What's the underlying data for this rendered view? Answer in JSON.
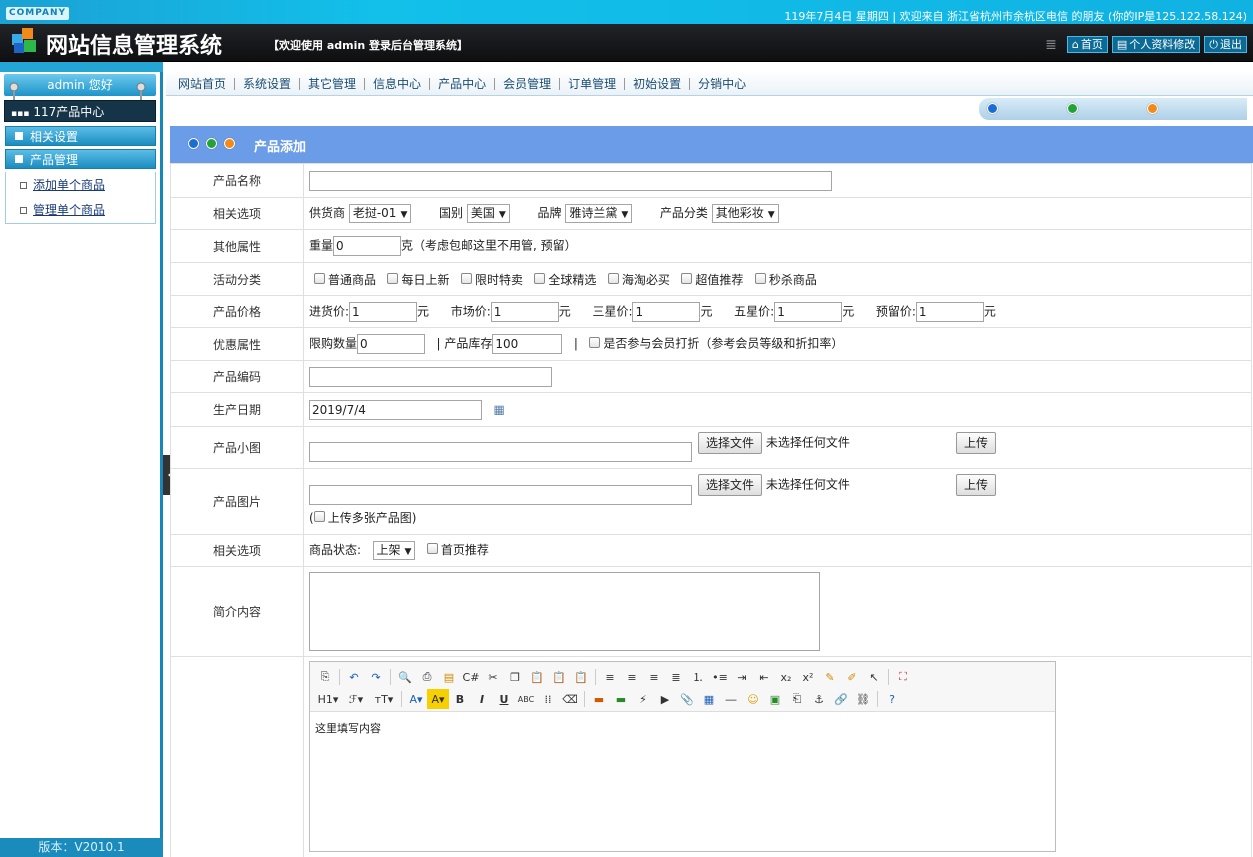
{
  "header": {
    "logo_badge": "COMPANY",
    "info": "119年7月4日  星期四 | 欢迎来自 浙江省杭州市余杭区电信 的朋友 (你的IP是125.122.58.124)",
    "site_title": "网站信息管理系统",
    "welcome": "【欢迎使用 admin 登录后台管理系统】",
    "buttons": {
      "home": "首页",
      "profile": "个人资料修改",
      "logout": "退出"
    }
  },
  "sidebar": {
    "user": "admin 您好",
    "center": "117产品中心",
    "sections": [
      {
        "label": "相关设置"
      },
      {
        "label": "产品管理"
      }
    ],
    "items": [
      {
        "label": "添加单个商品"
      },
      {
        "label": "管理单个商品"
      }
    ],
    "version": "版本：V2010.1"
  },
  "nav": {
    "items": [
      {
        "label": "网站首页"
      },
      {
        "label": "系统设置"
      },
      {
        "label": "其它管理"
      },
      {
        "label": "信息中心"
      },
      {
        "label": "产品中心"
      },
      {
        "label": "会员管理"
      },
      {
        "label": "订单管理"
      },
      {
        "label": "初始设置"
      },
      {
        "label": "分销中心"
      }
    ]
  },
  "colors": {
    "accent_blue": "#1b8bbc",
    "title_bar": "#6a9ce8",
    "dot_blue": "#1a6dd4",
    "dot_green": "#22a33a",
    "dot_orange": "#f28a1a"
  },
  "form": {
    "title": "产品添加",
    "rows": {
      "name": {
        "label": "产品名称",
        "value": ""
      },
      "options": {
        "label": "相关选项",
        "supplier_label": "供货商",
        "supplier_value": "老挝-01",
        "country_label": "国别",
        "country_value": "美国",
        "brand_label": "品牌",
        "brand_value": "雅诗兰黛",
        "category_label": "产品分类",
        "category_value": "其他彩妆"
      },
      "other": {
        "label": "其他属性",
        "weight_label": "重量",
        "weight_value": "0",
        "weight_note": "克（考虑包邮这里不用管, 预留）"
      },
      "activity": {
        "label": "活动分类",
        "options": [
          "普通商品",
          "每日上新",
          "限时特卖",
          "全球精选",
          "海淘必买",
          "超值推荐",
          "秒杀商品"
        ]
      },
      "price": {
        "label": "产品价格",
        "purchase_label": "进货价:",
        "purchase_value": "1",
        "market_label": "市场价:",
        "market_value": "1",
        "three_label": "三星价:",
        "three_value": "1",
        "five_label": "五星价:",
        "five_value": "1",
        "reserve_label": "预留价:",
        "reserve_value": "1",
        "unit": "元"
      },
      "discount": {
        "label": "优惠属性",
        "limit_label": "限购数量",
        "limit_value": "0",
        "sep": "|",
        "stock_label": "产品库存",
        "stock_value": "100",
        "member_label": "是否参与会员打折（参考会员等级和折扣率）"
      },
      "code": {
        "label": "产品编码",
        "value": ""
      },
      "date": {
        "label": "生产日期",
        "value": "2019/7/4"
      },
      "small_image": {
        "label": "产品小图",
        "choose": "选择文件",
        "none": "未选择任何文件",
        "upload": "上传"
      },
      "image": {
        "label": "产品图片",
        "choose": "选择文件",
        "none": "未选择任何文件",
        "upload": "上传",
        "multi_open": "(",
        "multi": "上传多张产品图)"
      },
      "status": {
        "label": "相关选项",
        "state_label": "商品状态:",
        "state_value": "上架",
        "home_label": "首页推荐"
      },
      "intro": {
        "label": "简介内容",
        "value": ""
      },
      "content": {
        "placeholder": "这里填写内容",
        "h1": "H1",
        "font": "ℱ",
        "size": "тT"
      }
    }
  }
}
